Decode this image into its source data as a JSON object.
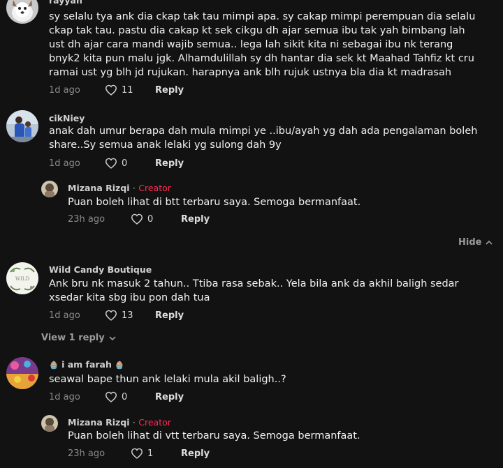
{
  "comments": [
    {
      "username": "rayyan",
      "lines": [
        "sy selalu tya ank dia ckap tak tau mimpi apa. sy cakap mimpi perempuan dia selalu",
        "ckap tak tau. pastu dia cakap kt sek cikgu dh ajar semua ibu tak yah bimbang lah",
        "ust dh ajar cara mandi wajib semua.. lega lah sikit kita ni sebagai ibu nk terang",
        "bnyk2 kita pun malu jgk. Alhamdulillah sy dh hantar dia sek kt Maahad Tahfiz kt cru",
        "ramai ust yg blh jd rujukan. harapnya ank blh rujuk ustnya bla dia kt madrasah"
      ],
      "time": "1d ago",
      "likes": "11",
      "reply": "Reply"
    },
    {
      "username": "cikNiey",
      "lines": [
        "anak dah umur berapa dah mula mimpi ye ..ibu/ayah yg dah ada pengalaman boleh",
        "share..Sy semua anak lelaki yg sulong dah 9y"
      ],
      "time": "1d ago",
      "likes": "0",
      "reply": "Reply",
      "replies": [
        {
          "username": "Mizana Rizqi",
          "separator": "·",
          "badge": "Creator",
          "lines": [
            "Puan boleh lihat di btt terbaru saya. Semoga bermanfaat."
          ],
          "time": "23h ago",
          "likes": "0",
          "reply": "Reply"
        }
      ],
      "hide_label": "Hide"
    },
    {
      "username": "Wild Candy Boutique",
      "lines": [
        "Ank bru nk masuk 2 tahun.. Ttiba rasa sebak.. Yela bila ank da akhil baligh sedar",
        "xsedar kita sbg ibu pon dah tua"
      ],
      "time": "1d ago",
      "likes": "13",
      "reply": "Reply",
      "view_replies": "View 1 reply"
    },
    {
      "username": "i am farah",
      "name_emoji": "🧁",
      "lines": [
        "seawal bape thun ank lelaki mula akil baligh..?"
      ],
      "time": "1d ago",
      "likes": "0",
      "reply": "Reply",
      "replies": [
        {
          "username": "Mizana Rizqi",
          "separator": "·",
          "badge": "Creator",
          "lines": [
            "Puan boleh lihat di vtt terbaru saya. Semoga bermanfaat."
          ],
          "time": "23h ago",
          "likes": "1",
          "reply": "Reply"
        }
      ]
    }
  ]
}
